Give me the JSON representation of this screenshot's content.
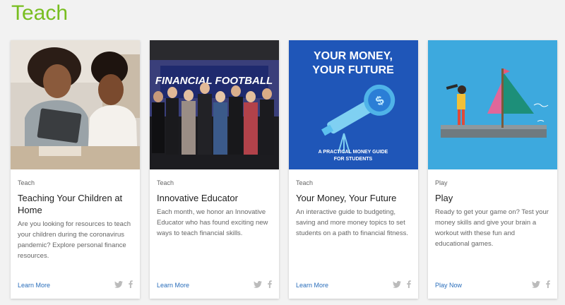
{
  "section": {
    "title": "Teach",
    "accent": "#78be20"
  },
  "cards": [
    {
      "category": "Teach",
      "title": "Teaching Your Children at Home",
      "description": "Are you looking for resources to teach your children during the coronavirus pandemic? Explore personal finance resources.",
      "cta": "Learn More",
      "image": "mother-daughter-tablet-photo"
    },
    {
      "category": "Teach",
      "title": "Innovative Educator",
      "description": "Each month, we honor an Innovative Educator who has found exciting new ways to teach financial skills.",
      "cta": "Learn More",
      "image": "group-photo-financial-football"
    },
    {
      "category": "Teach",
      "title": "Your Money, Your Future",
      "description": "An interactive guide to budgeting, saving and more money topics to set students on a path to financial fitness.",
      "cta": "Learn More",
      "image_title_lines": [
        "YOUR MONEY,",
        "YOUR FUTURE"
      ],
      "image_subtitle_lines": [
        "A PRACTICAL MONEY GUIDE",
        "FOR STUDENTS"
      ],
      "banner_text": "FINANCIAL FOOTBALL"
    },
    {
      "category": "Play",
      "title": "Play",
      "description": "Ready to get your game on? Test your money skills and give your brain a workout with these fun and educational games.",
      "cta": "Play Now",
      "image": "sailboat-illustration"
    }
  ],
  "social_icons": [
    "twitter-icon",
    "facebook-icon"
  ],
  "banner_text": "FINANCIAL FOOTBALL"
}
